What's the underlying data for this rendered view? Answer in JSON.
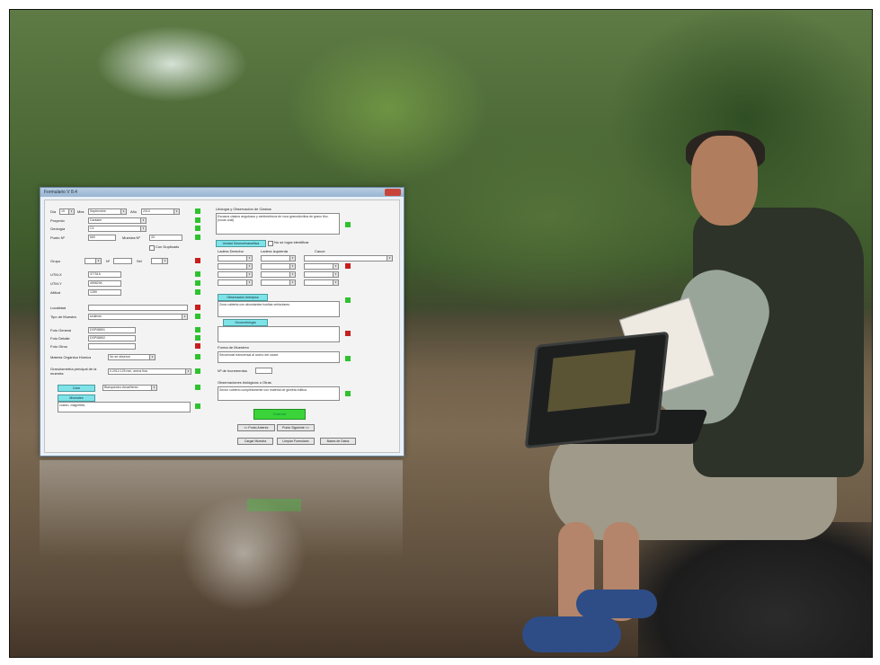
{
  "window": {
    "title": "Formulario V 8.4"
  },
  "left": {
    "dia_label": "Día",
    "dia_value": "15",
    "mes_label": "Mes",
    "mes_value": "Septiembre",
    "ano_label": "Año",
    "ano_value": "2010",
    "proyecto_label": "Proyecto",
    "proyecto_value": "Cantabri",
    "geologia_label": "Geología",
    "geologia_value": "C4",
    "punto_label": "Punto Nº",
    "punto_value": "660",
    "muestra_label": "Muestra Nº",
    "muestra_value": "33",
    "duplicado_label": "Con Duplicado",
    "grupo_label": "Grupo",
    "n_label": "Nº",
    "sel_label": "Sel",
    "utmx_label": "UTM-X",
    "utmx_value": "377516",
    "utmy_label": "UTM-Y",
    "utmy_value": "4598294",
    "altitud_label": "Altitud",
    "altitud_value": "1289",
    "localidad_label": "Localidad",
    "tipo_label": "Tipo de Muestra",
    "tipo_value": "sedimen",
    "foto_general_label": "Foto General",
    "foto_general_value": "DSP08891",
    "foto_detalle_label": "Foto Detalle",
    "foto_detalle_value": "DSP08892",
    "foto_otros_label": "Foto Otros",
    "materia_label": "Materia Orgánica Húmica",
    "materia_value": "No se observa",
    "granulometria_label": "Granulometría principal de la muestra",
    "granulometria_value": "0.2010 125 mm, arena fina",
    "color_button": "Color",
    "color_value": "Blanquecino Amarillento",
    "minerales_button": "Minerales",
    "minerales_value": "cuarzo, magnetita,"
  },
  "right": {
    "litologia_label": "Litología y Observación de Clastos",
    "litologia_text": "Escasos clastos angulosos y centimétricos de roca granodiorítica de grano fino. (rocas coal)",
    "unidad_button": "Unidad Geomorfoanalítica",
    "unidad_check_label": "No se logra identificar",
    "ladera_derecha_label": "Ladera Derecha",
    "ladera_izquierda_label": "Ladera Izquierda",
    "cauce_label": "Cauce",
    "obs_antropica_button": "Observación Antrópica",
    "obs_antropica_text": "Zona cubierta con abundantes huellas vehiculares.",
    "geomorfologia_button": "Geomorfología",
    "forma_label": "Forma de Muestreo",
    "forma_text": "Secuencial transversal al ancho del cauce.",
    "incrementos_label": "Nº de Incrementos",
    "obs_biologicas_label": "Observaciones biológicas u Otras",
    "obs_biologicas_text": "Sector cubierto completamente con material de glorieta edilica.",
    "guardar_button": "Guardar",
    "anterior_button": "<< Punto Anterior",
    "siguiente_button": "Punto Siguiente >>",
    "cargar_button": "Cargar Muestra",
    "limpiar_button": "Limpiar Formulario",
    "bases_button": "Bases de Datos"
  },
  "colors": {
    "status_green": "#2fc22f",
    "status_red": "#c81e1e",
    "button_cyan": "#7ee3e8",
    "save_green": "#3ad43a"
  }
}
